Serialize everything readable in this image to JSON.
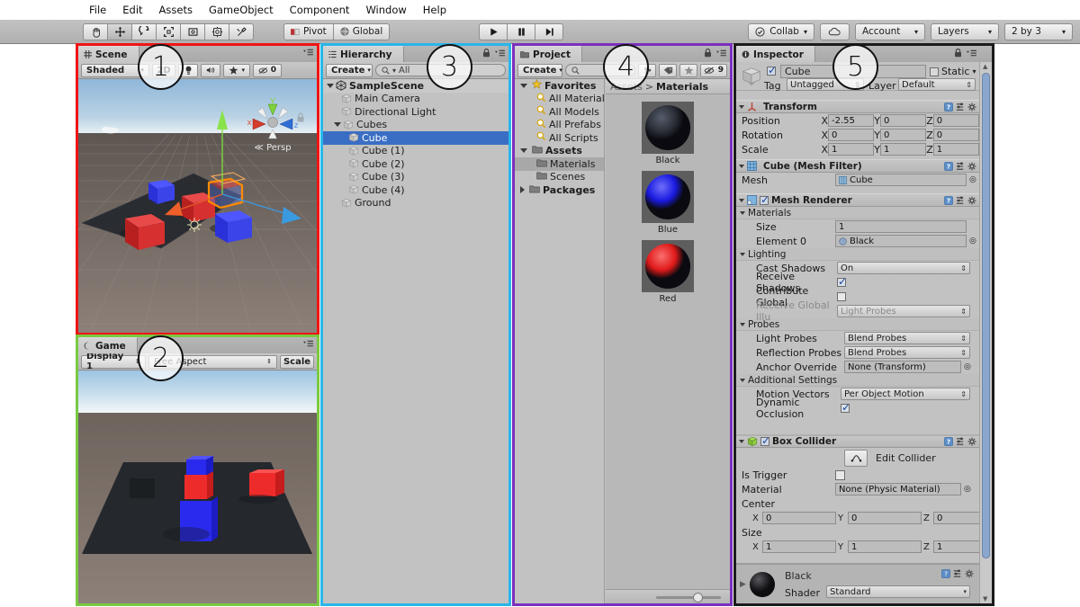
{
  "menubar": {
    "items": [
      "File",
      "Edit",
      "Assets",
      "GameObject",
      "Component",
      "Window",
      "Help"
    ]
  },
  "toolbar": {
    "tools": [
      "hand-tool",
      "move-tool",
      "rotate-tool",
      "scale-tool",
      "rect-tool",
      "transform-tool",
      "custom-tool"
    ],
    "pivot_label": "Pivot",
    "global_label": "Global",
    "play_label": "play",
    "pause_label": "pause",
    "step_label": "step",
    "collab_label": "Collab",
    "cloud_label": "cloud",
    "account_label": "Account",
    "layers_label": "Layers",
    "layout_label": "2 by 3"
  },
  "annotations": [
    {
      "n": "1",
      "target": "scene-view"
    },
    {
      "n": "2",
      "target": "game-view"
    },
    {
      "n": "3",
      "target": "hierarchy-panel"
    },
    {
      "n": "4",
      "target": "project-panel"
    },
    {
      "n": "5",
      "target": "inspector-panel"
    }
  ],
  "scene": {
    "tab_label": "Scene",
    "draw_mode": "Shaded",
    "toggle_2d": "2D",
    "lighting_icon": "lightbulb-icon",
    "audio_icon": "speaker-icon",
    "fx_icon": "fx-icon",
    "hidden_count": "0",
    "gizmo_axes": [
      "y",
      "x",
      "z"
    ],
    "persp_label": "Persp",
    "border_color": "#f01414"
  },
  "game": {
    "tab_label": "Game",
    "display_label": "Display 1",
    "aspect_label": "Free Aspect",
    "scale_label": "Scale",
    "border_color": "#7ac943"
  },
  "hierarchy": {
    "tab_label": "Hierarchy",
    "create_label": "Create",
    "search_placeholder": "All",
    "border_color": "#29b6e8",
    "items": [
      {
        "label": "SampleScene",
        "depth": 0,
        "type": "scene",
        "expanded": true,
        "selected": false
      },
      {
        "label": "Main Camera",
        "depth": 2,
        "type": "object",
        "expanded": null,
        "selected": false
      },
      {
        "label": "Directional Light",
        "depth": 2,
        "type": "object",
        "expanded": null,
        "selected": false
      },
      {
        "label": "Cubes",
        "depth": 1,
        "type": "object",
        "expanded": true,
        "selected": false
      },
      {
        "label": "Cube",
        "depth": 3,
        "type": "object",
        "expanded": null,
        "selected": true
      },
      {
        "label": "Cube (1)",
        "depth": 3,
        "type": "object",
        "expanded": null,
        "selected": false
      },
      {
        "label": "Cube (2)",
        "depth": 3,
        "type": "object",
        "expanded": null,
        "selected": false
      },
      {
        "label": "Cube (3)",
        "depth": 3,
        "type": "object",
        "expanded": null,
        "selected": false
      },
      {
        "label": "Cube (4)",
        "depth": 3,
        "type": "object",
        "expanded": null,
        "selected": false
      },
      {
        "label": "Ground",
        "depth": 2,
        "type": "object",
        "expanded": null,
        "selected": false
      }
    ]
  },
  "project": {
    "tab_label": "Project",
    "create_label": "Create",
    "search_placeholder": "",
    "filter_icons": [
      "type-filter-icon",
      "label-filter-icon",
      "favorite-filter-icon"
    ],
    "hidden_count": "9",
    "breadcrumb": [
      "Assets",
      "Materials"
    ],
    "border_color": "#7b2fbe",
    "tree": [
      {
        "label": "Favorites",
        "depth": 0,
        "icon": "star-icon",
        "bold": true,
        "expanded": true,
        "selected": false
      },
      {
        "label": "All Material",
        "depth": 1,
        "icon": "search-icon",
        "bold": false,
        "expanded": null,
        "selected": false
      },
      {
        "label": "All Models",
        "depth": 1,
        "icon": "search-icon",
        "bold": false,
        "expanded": null,
        "selected": false
      },
      {
        "label": "All Prefabs",
        "depth": 1,
        "icon": "search-icon",
        "bold": false,
        "expanded": null,
        "selected": false
      },
      {
        "label": "All Scripts",
        "depth": 1,
        "icon": "search-icon",
        "bold": false,
        "expanded": null,
        "selected": false
      },
      {
        "label": "Assets",
        "depth": 0,
        "icon": "folder-icon",
        "bold": true,
        "expanded": true,
        "selected": false
      },
      {
        "label": "Materials",
        "depth": 1,
        "icon": "folder-icon",
        "bold": false,
        "expanded": null,
        "selected": true
      },
      {
        "label": "Scenes",
        "depth": 1,
        "icon": "folder-icon",
        "bold": false,
        "expanded": null,
        "selected": false
      },
      {
        "label": "Packages",
        "depth": 0,
        "icon": "folder-icon",
        "bold": true,
        "expanded": false,
        "selected": false
      }
    ],
    "assets": [
      {
        "name": "Black",
        "color": "#2b2f38",
        "highlight": "#565d6c"
      },
      {
        "name": "Blue",
        "color": "#1a1ae0",
        "highlight": "#6f6ffb"
      },
      {
        "name": "Red",
        "color": "#e01a1a",
        "highlight": "#fb7070"
      }
    ],
    "zoom_slider_value": 72
  },
  "inspector": {
    "tab_label": "Inspector",
    "border_color": "#1b1b1b",
    "object": {
      "enabled": true,
      "name": "Cube",
      "static_label": "Static",
      "static_checked": false,
      "tag_label": "Tag",
      "tag_value": "Untagged",
      "layer_label": "Layer",
      "layer_value": "Default"
    },
    "transform": {
      "title": "Transform",
      "rows": [
        {
          "label": "Position",
          "x": "-2.55",
          "y": "0",
          "z": "0"
        },
        {
          "label": "Rotation",
          "x": "0",
          "y": "0",
          "z": "0"
        },
        {
          "label": "Scale",
          "x": "1",
          "y": "1",
          "z": "1"
        }
      ]
    },
    "mesh_filter": {
      "title": "Cube (Mesh Filter)",
      "mesh_label": "Mesh",
      "mesh_value": "Cube"
    },
    "mesh_renderer": {
      "title": "Mesh Renderer",
      "enabled": true,
      "materials_label": "Materials",
      "size_label": "Size",
      "size_value": "1",
      "element0_label": "Element 0",
      "element0_value": "Black",
      "lighting_label": "Lighting",
      "cast_shadows_label": "Cast Shadows",
      "cast_shadows_value": "On",
      "receive_shadows_label": "Receive Shadows",
      "receive_shadows_checked": true,
      "contribute_gi_label": "Contribute Global",
      "contribute_gi_checked": false,
      "receive_gi_label": "Receive Global Illu",
      "receive_gi_value": "Light Probes",
      "probes_label": "Probes",
      "light_probes_label": "Light Probes",
      "light_probes_value": "Blend Probes",
      "reflection_probes_label": "Reflection Probes",
      "reflection_probes_value": "Blend Probes",
      "anchor_override_label": "Anchor Override",
      "anchor_override_value": "None (Transform)",
      "additional_label": "Additional Settings",
      "motion_vectors_label": "Motion Vectors",
      "motion_vectors_value": "Per Object Motion",
      "dynamic_occlusion_label": "Dynamic Occlusion",
      "dynamic_occlusion_checked": true
    },
    "box_collider": {
      "title": "Box Collider",
      "enabled": true,
      "edit_collider_label": "Edit Collider",
      "is_trigger_label": "Is Trigger",
      "is_trigger_checked": false,
      "material_label": "Material",
      "material_value": "None (Physic Material)",
      "center_label": "Center",
      "center": {
        "x": "0",
        "y": "0",
        "z": "0"
      },
      "size_label": "Size",
      "size": {
        "x": "1",
        "y": "1",
        "z": "1"
      }
    },
    "material_preview": {
      "name": "Black",
      "shader_label": "Shader",
      "shader_value": "Standard"
    }
  }
}
